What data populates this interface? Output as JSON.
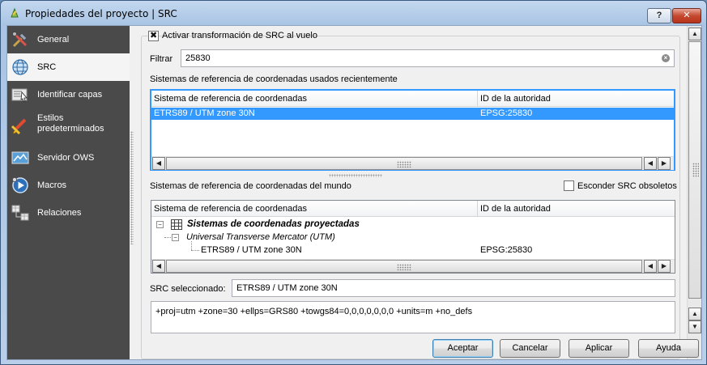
{
  "window": {
    "title": "Propiedades del proyecto | SRC",
    "help_label": "?",
    "close_label": "✕"
  },
  "sidebar": {
    "items": [
      {
        "label": "General",
        "icon": "tools-icon"
      },
      {
        "label": "SRC",
        "icon": "globe-icon"
      },
      {
        "label": "Identificar capas",
        "icon": "identify-icon"
      },
      {
        "label": "Estilos predeterminados",
        "label_line1": "Estilos",
        "label_line2": "predeterminados",
        "icon": "paint-brush-icon"
      },
      {
        "label": "Servidor OWS",
        "icon": "ows-icon"
      },
      {
        "label": "Macros",
        "icon": "macro-icon"
      },
      {
        "label": "Relaciones",
        "icon": "relations-icon"
      }
    ],
    "active_index": 1
  },
  "crs": {
    "enable_transform_label": "Activar transformación de SRC al vuelo",
    "enable_transform_checked": true,
    "filter_label": "Filtrar",
    "filter_value": "25830",
    "recent_label": "Sistemas de referencia de coordenadas usados recientemente",
    "recent_columns": [
      "Sistema de referencia de coordenadas",
      "ID de la autoridad"
    ],
    "recent_rows": [
      {
        "name": "ETRS89 / UTM zone 30N",
        "authid": "EPSG:25830",
        "selected": true
      }
    ],
    "world_label": "Sistemas de referencia de coordenadas del mundo",
    "hide_deprecated_label": "Esconder SRC obsoletos",
    "hide_deprecated_checked": false,
    "world_columns": [
      "Sistema de referencia de coordenadas",
      "ID de la autoridad"
    ],
    "world_tree": {
      "group": "Sistemas de coordenadas proyectadas",
      "subgroup": "Universal Transverse Mercator (UTM)",
      "leaf_name": "ETRS89 / UTM zone 30N",
      "leaf_authid": "EPSG:25830"
    },
    "selected_label": "SRC seleccionado:",
    "selected_value": "ETRS89 / UTM zone 30N",
    "proj4": "+proj=utm +zone=30 +ellps=GRS80 +towgs84=0,0,0,0,0,0,0 +units=m +no_defs"
  },
  "buttons": {
    "ok": "Aceptar",
    "cancel": "Cancelar",
    "apply": "Aplicar",
    "help": "Ayuda"
  },
  "colors": {
    "selection": "#3399ff",
    "sidebar_bg": "#4a4a4a"
  }
}
